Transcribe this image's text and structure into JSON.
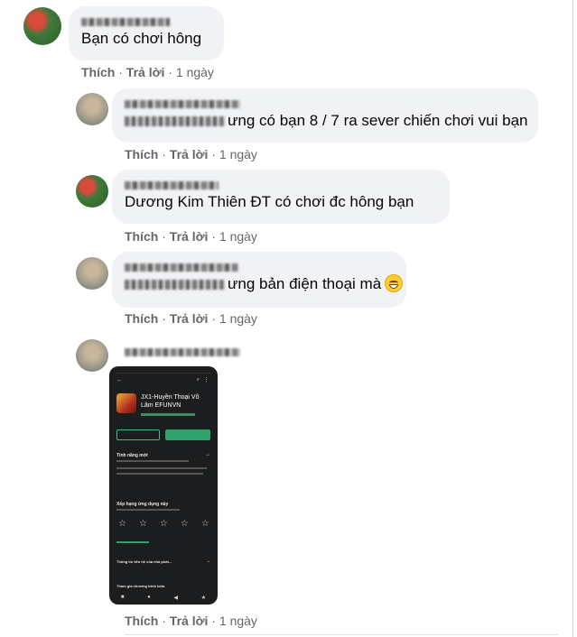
{
  "comments": [
    {
      "author_redacted": true,
      "text": "Bạn có chơi hông",
      "actions": {
        "like": "Thích",
        "reply": "Trả lời",
        "time": "1 ngày"
      }
    },
    {
      "author_redacted": true,
      "text": "ưng có bạn 8 / 7 ra sever chiến chơi vui bạn",
      "actions": {
        "like": "Thích",
        "reply": "Trả lời",
        "time": "1 ngày"
      }
    },
    {
      "author_redacted": true,
      "text": "Dương Kim Thiên ĐT có chơi đc hông bạn",
      "actions": {
        "like": "Thích",
        "reply": "Trả lời",
        "time": "1 ngày"
      }
    },
    {
      "author_redacted": true,
      "text": "ưng bản điện thoại mà",
      "emoji": "grinning-face-icon",
      "actions": {
        "like": "Thích",
        "reply": "Trả lời",
        "time": "1 ngày"
      }
    },
    {
      "author_redacted": true,
      "attachment": {
        "app_title": "JX1-Huyền Thoại Võ Lâm EFUNVN",
        "section_new": "Tính năng mới",
        "section_rate": "Xếp hạng ứng dụng này",
        "section_contact": "Thông tin liên hệ của nhà phát...",
        "section_beta": "Tham gia chương trình beta"
      },
      "actions": {
        "like": "Thích",
        "reply": "Trả lời",
        "time": "1 ngày"
      }
    }
  ],
  "sep": "·"
}
